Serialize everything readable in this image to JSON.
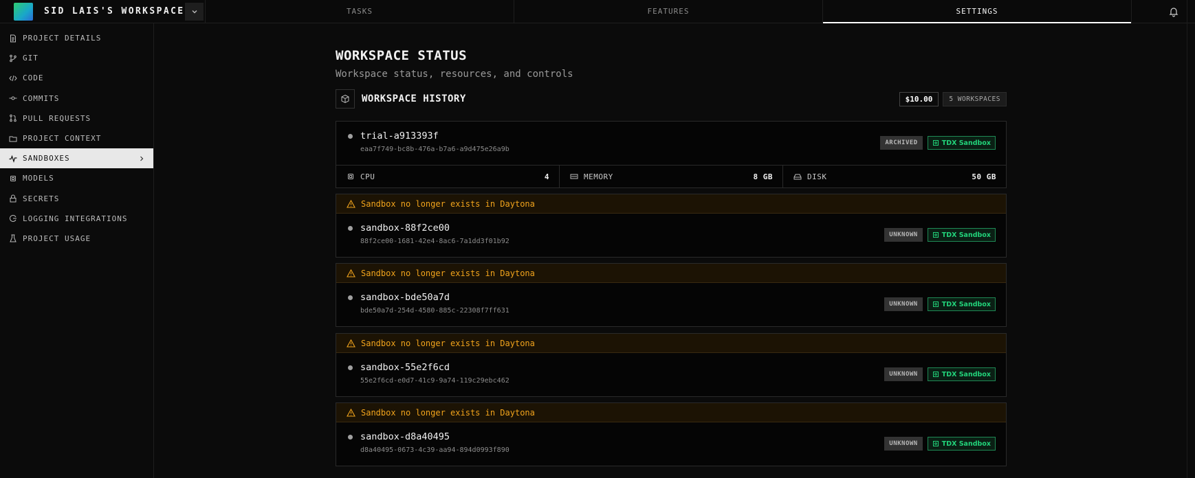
{
  "header": {
    "workspace_name": "SID LAIS'S WORKSPACE",
    "tabs": [
      {
        "label": "TASKS",
        "active": false
      },
      {
        "label": "FEATURES",
        "active": false
      },
      {
        "label": "SETTINGS",
        "active": true
      }
    ]
  },
  "sidebar": {
    "items": [
      {
        "label": "PROJECT DETAILS",
        "icon": "document-icon"
      },
      {
        "label": "GIT",
        "icon": "git-branch-icon"
      },
      {
        "label": "CODE",
        "icon": "code-icon"
      },
      {
        "label": "COMMITS",
        "icon": "commit-icon"
      },
      {
        "label": "PULL REQUESTS",
        "icon": "pull-request-icon"
      },
      {
        "label": "PROJECT CONTEXT",
        "icon": "folder-icon"
      },
      {
        "label": "SANDBOXES",
        "icon": "activity-icon",
        "active": true
      },
      {
        "label": "MODELS",
        "icon": "chip-icon"
      },
      {
        "label": "SECRETS",
        "icon": "lock-icon"
      },
      {
        "label": "LOGGING INTEGRATIONS",
        "icon": "logging-icon"
      },
      {
        "label": "PROJECT USAGE",
        "icon": "flask-icon"
      }
    ]
  },
  "main": {
    "title": "WORKSPACE STATUS",
    "subtitle": "Workspace status, resources, and controls",
    "history": {
      "title": "WORKSPACE HISTORY",
      "price": "$10.00",
      "count": "5 WORKSPACES"
    },
    "warning_text": "Sandbox no longer exists in Daytona",
    "resources": [
      {
        "label": "CPU",
        "value": "4",
        "icon": "cpu-icon"
      },
      {
        "label": "MEMORY",
        "value": "8 GB",
        "icon": "memory-icon"
      },
      {
        "label": "DISK",
        "value": "50 GB",
        "icon": "disk-icon"
      }
    ],
    "sandboxes": [
      {
        "name": "trial-a913393f",
        "id": "eaa7f749-bc8b-476a-b7a6-a9d475e26a9b",
        "status": "ARCHIVED",
        "type": "TDX Sandbox"
      },
      {
        "name": "sandbox-88f2ce00",
        "id": "88f2ce00-1681-42e4-8ac6-7a1dd3f01b92",
        "status": "UNKNOWN",
        "type": "TDX Sandbox"
      },
      {
        "name": "sandbox-bde50a7d",
        "id": "bde50a7d-254d-4580-885c-22308f7ff631",
        "status": "UNKNOWN",
        "type": "TDX Sandbox"
      },
      {
        "name": "sandbox-55e2f6cd",
        "id": "55e2f6cd-e0d7-41c9-9a74-119c29ebc462",
        "status": "UNKNOWN",
        "type": "TDX Sandbox"
      },
      {
        "name": "sandbox-d8a40495",
        "id": "d8a40495-0673-4c39-aa94-894d0993f890",
        "status": "UNKNOWN",
        "type": "TDX Sandbox"
      }
    ]
  }
}
